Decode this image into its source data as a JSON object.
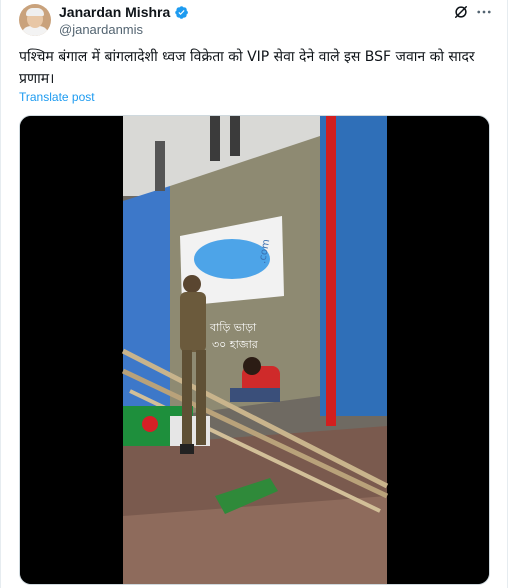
{
  "author": {
    "display_name": "Janardan Mishra",
    "handle": "@janardanmis",
    "verified": true,
    "avatar_icon": "user-avatar"
  },
  "actions": {
    "grok_icon": "grok-icon",
    "more_icon": "more-horizontal-icon"
  },
  "tweet": {
    "text": "पश्चिम बंगाल में बांगलादेशी ध्वज विक्रेता को VIP सेवा देने वाले इस BSF जवान को सादर प्रणाम।",
    "translate_label": "Translate post"
  },
  "media": {
    "type": "video",
    "sign_text": ".com",
    "wall_text_line1": "বাড়ি ভাড়া",
    "wall_text_line2": "৩০ হাজার"
  },
  "colors": {
    "accent": "#1d9bf0",
    "text_primary": "#0f1419",
    "text_secondary": "#536471"
  }
}
